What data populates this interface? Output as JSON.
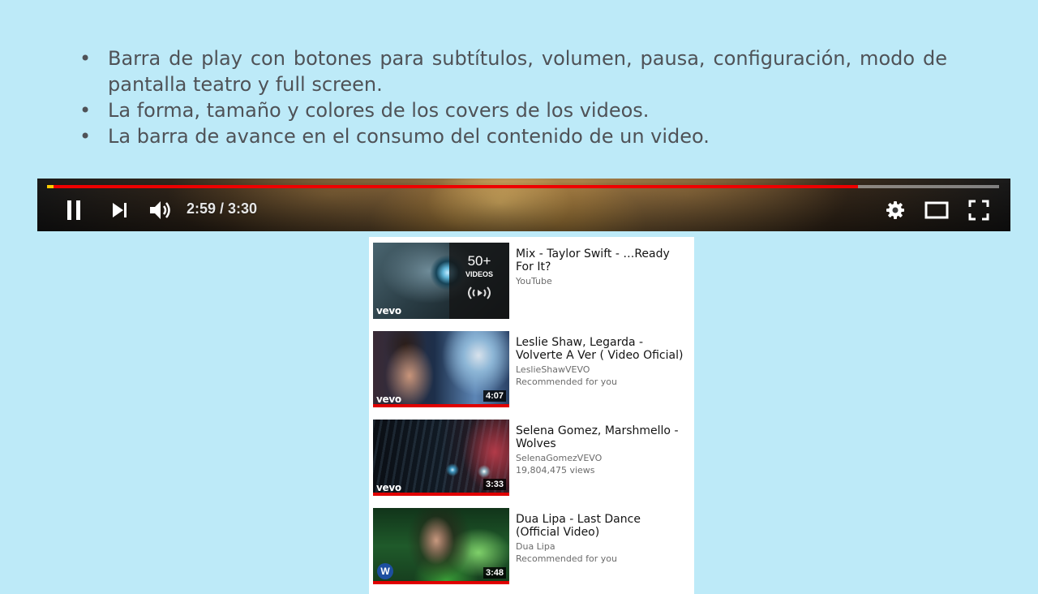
{
  "bullets": [
    "Barra de play con botones para subtítulos, volumen, pausa, configuración, modo de pantalla teatro y full screen.",
    "La forma, tamaño y colores de los covers de los videos.",
    "La barra de avance en el consumo del contenido de un video."
  ],
  "bullet_symbol": "•",
  "player": {
    "time": "2:59 / 3:30",
    "progress_fraction": 0.852,
    "colors": {
      "progress": "#ee0000",
      "buffer_start": "#ffcc00"
    },
    "icons": [
      "pause-icon",
      "next-icon",
      "volume-icon",
      "settings-icon",
      "theater-mode-icon",
      "fullscreen-icon"
    ]
  },
  "recommendations": [
    {
      "title": "Mix - Taylor Swift - …Ready For It?",
      "channel": "YouTube",
      "meta": "",
      "badge": "vevo",
      "playlist_count": "50+",
      "playlist_unit": "VIDEOS"
    },
    {
      "title": "Leslie Shaw, Legarda - Volverte A Ver ( Video Oficial)",
      "channel": "LeslieShawVEVO",
      "meta": "Recommended for you",
      "badge": "vevo",
      "duration": "4:07"
    },
    {
      "title": "Selena Gomez, Marshmello - Wolves",
      "channel": "SelenaGomezVEVO",
      "meta": "19,804,475 views",
      "badge": "vevo",
      "duration": "3:33"
    },
    {
      "title": "Dua Lipa - Last Dance (Official Video)",
      "channel": "Dua Lipa",
      "meta": "Recommended for you",
      "badge": "W",
      "duration": "3:48"
    }
  ]
}
